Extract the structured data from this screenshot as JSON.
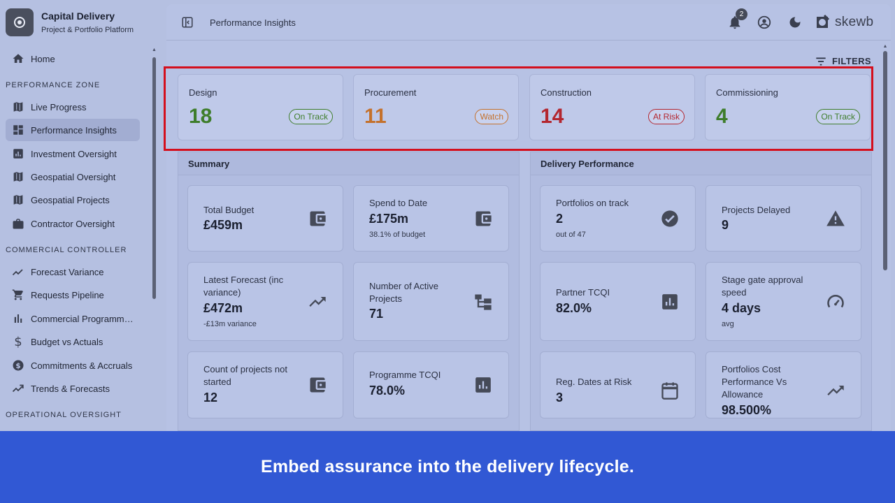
{
  "brand": {
    "title": "Capital Delivery",
    "subtitle": "Project & Portfolio Platform"
  },
  "sidebar": {
    "home": "Home",
    "sections": [
      "PERFORMANCE ZONE",
      "COMMERCIAL CONTROLLER",
      "OPERATIONAL OVERSIGHT"
    ],
    "performance_items": [
      {
        "label": "Live Progress",
        "icon": "map-icon"
      },
      {
        "label": "Performance Insights",
        "icon": "dashboard-icon"
      },
      {
        "label": "Investment Oversight",
        "icon": "bar-chart-icon"
      },
      {
        "label": "Geospatial Oversight",
        "icon": "map-icon"
      },
      {
        "label": "Geospatial Projects",
        "icon": "map-icon"
      },
      {
        "label": "Contractor Oversight",
        "icon": "briefcase-icon"
      }
    ],
    "commercial_items": [
      {
        "label": "Forecast Variance",
        "icon": "trend-icon"
      },
      {
        "label": "Requests Pipeline",
        "icon": "cart-icon"
      },
      {
        "label": "Commercial Programme...",
        "icon": "bars-icon"
      },
      {
        "label": "Budget vs Actuals",
        "icon": "dollar-icon"
      },
      {
        "label": "Commitments & Accruals",
        "icon": "dollar-circle-icon"
      },
      {
        "label": "Trends & Forecasts",
        "icon": "trend-icon"
      }
    ]
  },
  "topbar": {
    "page_title": "Performance Insights",
    "notification_count": "2",
    "logo_text": "skewb"
  },
  "filters_label": "FILTERS",
  "status_cards": [
    {
      "phase": "Design",
      "count": "18",
      "status": "On Track",
      "color": "#3e7d2b"
    },
    {
      "phase": "Procurement",
      "count": "11",
      "status": "Watch",
      "color": "#c4712c"
    },
    {
      "phase": "Construction",
      "count": "14",
      "status": "At Risk",
      "color": "#b3262f"
    },
    {
      "phase": "Commissioning",
      "count": "4",
      "status": "On Track",
      "color": "#3e7d2b"
    }
  ],
  "summary": {
    "title": "Summary",
    "metrics": [
      {
        "label": "Total Budget",
        "value": "£459m",
        "sub": "",
        "icon": "wallet-icon"
      },
      {
        "label": "Spend to Date",
        "value": "£175m",
        "sub": "38.1% of budget",
        "icon": "wallet-icon"
      },
      {
        "label": "Latest Forecast (inc variance)",
        "value": "£472m",
        "sub": "-£13m variance",
        "icon": "trending-up-icon"
      },
      {
        "label": "Number of Active Projects",
        "value": "71",
        "sub": "",
        "icon": "hierarchy-icon"
      },
      {
        "label": "Count of projects not started",
        "value": "12",
        "sub": "",
        "icon": "wallet-icon"
      },
      {
        "label": "Programme TCQI",
        "value": "78.0%",
        "sub": "",
        "icon": "bar-chart-icon"
      }
    ]
  },
  "delivery": {
    "title": "Delivery Performance",
    "metrics": [
      {
        "label": "Portfolios on track",
        "value": "2",
        "sub": "out of 47",
        "icon": "check-circle-icon"
      },
      {
        "label": "Projects Delayed",
        "value": "9",
        "sub": "",
        "icon": "warning-icon"
      },
      {
        "label": "Partner TCQI",
        "value": "82.0%",
        "sub": "",
        "icon": "bar-chart-icon"
      },
      {
        "label": "Stage gate approval speed",
        "value": "4 days",
        "sub": "avg",
        "icon": "speedometer-icon"
      },
      {
        "label": "Reg. Dates at Risk",
        "value": "3",
        "sub": "",
        "icon": "calendar-icon"
      },
      {
        "label": "Portfolios Cost Performance Vs Allowance",
        "value": "98.500%",
        "sub": "",
        "icon": "trending-up-icon"
      }
    ]
  },
  "caption": "Embed assurance into the delivery lifecycle."
}
